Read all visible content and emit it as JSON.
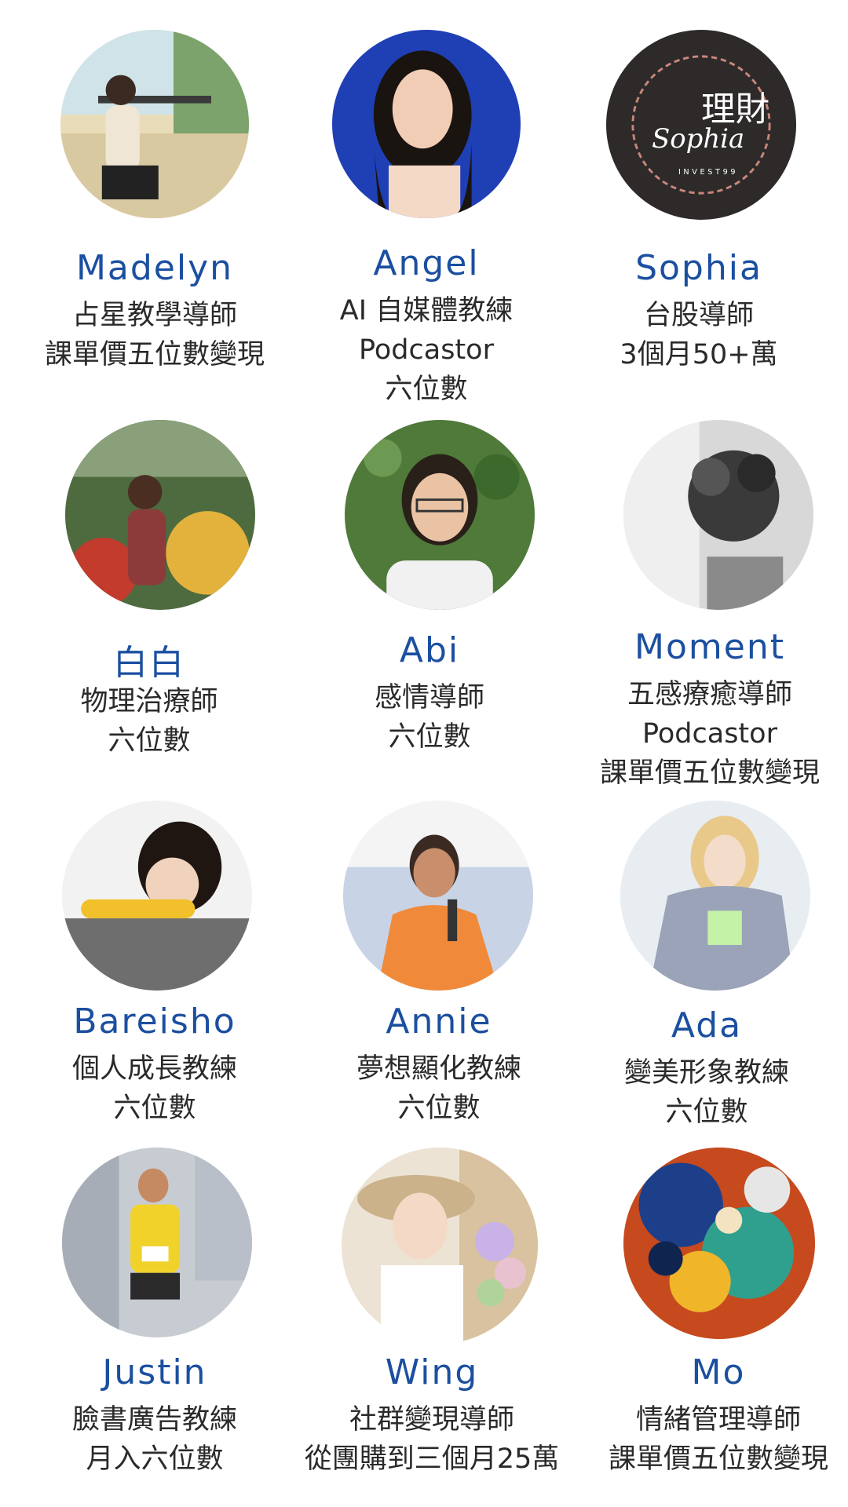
{
  "people": [
    {
      "name": "Madelyn",
      "lines": [
        "占星教學導師",
        "課單價五位數變現"
      ],
      "avatar_icon": "woman-in-cafe-photo"
    },
    {
      "name": "Angel",
      "lines": [
        "AI 自媒體教練",
        "Podcastor",
        "六位數"
      ],
      "avatar_icon": "woman-portrait-blue-photo"
    },
    {
      "name": "Sophia",
      "lines": [
        "台股導師",
        "3個月50+萬"
      ],
      "avatar_icon": "sophia-invest-logo",
      "logo_text": [
        "Sophia",
        "理財",
        "INVEST99"
      ]
    },
    {
      "name": "白白",
      "lines": [
        "物理治療師",
        "六位數"
      ],
      "avatar_icon": "woman-in-flower-shop-photo"
    },
    {
      "name": "Abi",
      "lines": [
        "感情導師",
        "六位數"
      ],
      "avatar_icon": "woman-glasses-greenery-photo"
    },
    {
      "name": "Moment",
      "lines": [
        "五感療癒導師",
        "Podcastor",
        "課單價五位數變現"
      ],
      "avatar_icon": "curly-hair-bw-photo"
    },
    {
      "name": "Bareisho",
      "lines": [
        "個人成長教練",
        "六位數"
      ],
      "avatar_icon": "woman-resting-photo"
    },
    {
      "name": "Annie",
      "lines": [
        "夢想顯化教練",
        "六位數"
      ],
      "avatar_icon": "woman-microphone-photo"
    },
    {
      "name": "Ada",
      "lines": [
        "變美形象教練",
        "六位數"
      ],
      "avatar_icon": "woman-fashion-photo"
    },
    {
      "name": "Justin",
      "lines": [
        "臉書廣告教練",
        "月入六位數"
      ],
      "avatar_icon": "runner-marathon-photo"
    },
    {
      "name": "Wing",
      "lines": [
        "社群變現導師",
        "從團購到三個月25萬"
      ],
      "avatar_icon": "woman-hat-flowers-photo"
    },
    {
      "name": "Mo",
      "lines": [
        "情緒管理導師",
        "課單價五位數變現"
      ],
      "avatar_icon": "fluid-art-painting"
    }
  ],
  "colors": {
    "name": "#1b4fa0",
    "text": "#2a2a2a",
    "background": "#ffffff"
  }
}
